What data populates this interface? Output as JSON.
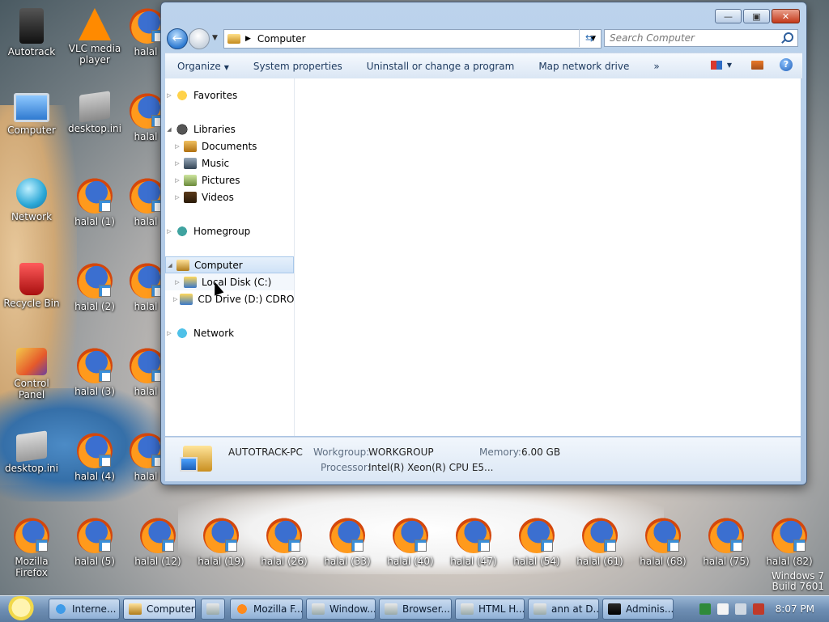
{
  "desktop": {
    "icons": [
      {
        "label": "Autotrack",
        "icon": "autotrack-icon"
      },
      {
        "label": "VLC media player",
        "icon": "vlc-icon"
      },
      {
        "label": "halal",
        "icon": "firefox-shortcut-icon"
      },
      {
        "label": "Computer",
        "icon": "computer-icon"
      },
      {
        "label": "desktop.ini",
        "icon": "ini-file-icon"
      },
      {
        "label": "halal",
        "icon": "firefox-shortcut-icon"
      },
      {
        "label": "Network",
        "icon": "network-icon"
      },
      {
        "label": "halal (1)",
        "icon": "firefox-shortcut-icon"
      },
      {
        "label": "halal",
        "icon": "firefox-shortcut-icon"
      },
      {
        "label": "Recycle Bin",
        "icon": "recycle-bin-icon"
      },
      {
        "label": "halal (2)",
        "icon": "firefox-shortcut-icon"
      },
      {
        "label": "halal",
        "icon": "firefox-shortcut-icon"
      },
      {
        "label": "Control Panel",
        "icon": "control-panel-icon"
      },
      {
        "label": "halal (3)",
        "icon": "firefox-shortcut-icon"
      },
      {
        "label": "halal",
        "icon": "firefox-shortcut-icon"
      },
      {
        "label": "desktop.ini",
        "icon": "ini-file-icon"
      },
      {
        "label": "halal (4)",
        "icon": "firefox-shortcut-icon"
      },
      {
        "label": "halal",
        "icon": "firefox-shortcut-icon"
      },
      {
        "label": "Mozilla Firefox",
        "icon": "firefox-icon"
      },
      {
        "label": "halal (5)",
        "icon": "firefox-shortcut-icon"
      },
      {
        "label": "halal (12)",
        "icon": "firefox-shortcut-icon"
      },
      {
        "label": "halal (19)",
        "icon": "firefox-shortcut-icon"
      },
      {
        "label": "halal (26)",
        "icon": "firefox-shortcut-icon"
      },
      {
        "label": "halal (33)",
        "icon": "firefox-shortcut-icon"
      },
      {
        "label": "halal (40)",
        "icon": "firefox-shortcut-icon"
      },
      {
        "label": "halal (47)",
        "icon": "firefox-shortcut-icon"
      },
      {
        "label": "halal (54)",
        "icon": "firefox-shortcut-icon"
      },
      {
        "label": "halal (61)",
        "icon": "firefox-shortcut-icon"
      },
      {
        "label": "halal (68)",
        "icon": "firefox-shortcut-icon"
      },
      {
        "label": "halal (75)",
        "icon": "firefox-shortcut-icon"
      },
      {
        "label": "halal (82)",
        "icon": "firefox-shortcut-icon"
      }
    ],
    "watermark_line1": "Windows 7",
    "watermark_line2": "Build 7601"
  },
  "explorer": {
    "address": "Computer",
    "search_placeholder": "Search Computer",
    "toolbar": {
      "organize": "Organize",
      "system_properties": "System properties",
      "uninstall": "Uninstall or change a program",
      "map_drive": "Map network drive",
      "more": "»"
    },
    "nav": {
      "favorites": "Favorites",
      "libraries": "Libraries",
      "documents": "Documents",
      "music": "Music",
      "pictures": "Pictures",
      "videos": "Videos",
      "homegroup": "Homegroup",
      "computer": "Computer",
      "local_disk": "Local Disk (C:)",
      "cd_drive": "CD Drive (D:) CDROM",
      "network": "Network"
    },
    "details": {
      "pc_name": "AUTOTRACK-PC",
      "workgroup_label": "Workgroup:",
      "workgroup_value": "WORKGROUP",
      "memory_label": "Memory:",
      "memory_value": "6.00 GB",
      "processor_label": "Processor:",
      "processor_value": "Intel(R) Xeon(R) CPU E5..."
    }
  },
  "taskbar": {
    "buttons": [
      {
        "label": "Interne...",
        "icon": "ie-icon"
      },
      {
        "label": "Computer",
        "icon": "computer-icon"
      },
      {
        "label": "",
        "icon": "media-icon"
      },
      {
        "label": "Mozilla F...",
        "icon": "firefox-icon"
      },
      {
        "label": "Window...",
        "icon": "window-icon"
      },
      {
        "label": "Browser...",
        "icon": "browser-icon"
      },
      {
        "label": "HTML H...",
        "icon": "html-help-icon"
      },
      {
        "label": "ann at D...",
        "icon": "app-icon"
      },
      {
        "label": "Adminis...",
        "icon": "cmd-icon"
      }
    ],
    "clock": "8:07 PM"
  }
}
